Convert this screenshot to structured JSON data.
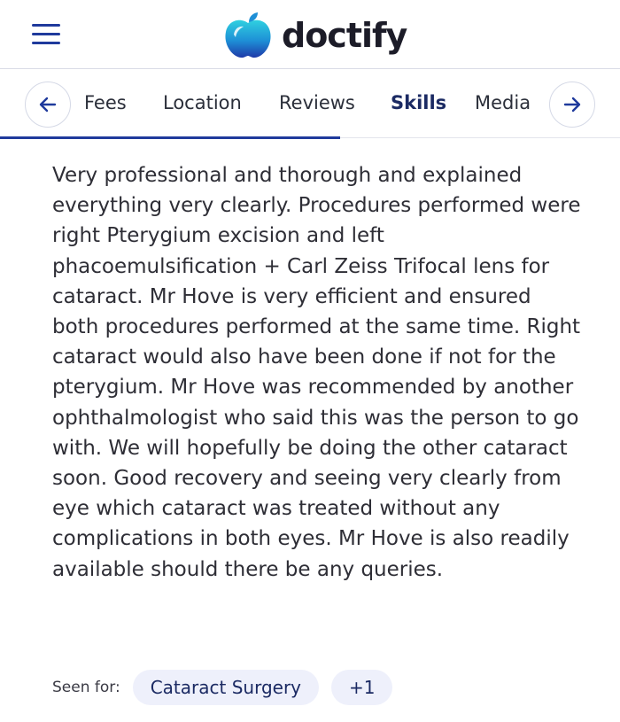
{
  "header": {
    "brand": "doctify",
    "menu_icon": "hamburger-menu-icon",
    "brand_colors": {
      "top": "#26c6da",
      "bottom": "#1f3aa8"
    }
  },
  "tabs": {
    "prev_icon": "arrow-left-icon",
    "next_icon": "arrow-right-icon",
    "items": [
      {
        "label": "Fees"
      },
      {
        "label": "Location"
      },
      {
        "label": "Reviews"
      },
      {
        "label": "Skills"
      },
      {
        "label": "Media"
      }
    ],
    "active": "Skills",
    "accent_color": "#1f3a9c"
  },
  "review": {
    "text": "Very professional and thorough and explained everything very clearly. Procedures performed were right Pterygium excision and left phacoemulsification + Carl Zeiss Trifocal lens for cataract. Mr Hove is very efficient and ensured both procedures performed at the same time. Right cataract would also have been done if not for the pterygium. Mr Hove was recommended by another ophthalmologist who said this was the person to go with. We will hopefully be doing the other cataract soon. Good recovery and seeing very clearly from eye which cataract was treated without any complications in both eyes. Mr Hove is also readily available should there be any queries."
  },
  "seen_for": {
    "label": "Seen for:",
    "chips": [
      "Cataract Surgery",
      "+1"
    ]
  }
}
